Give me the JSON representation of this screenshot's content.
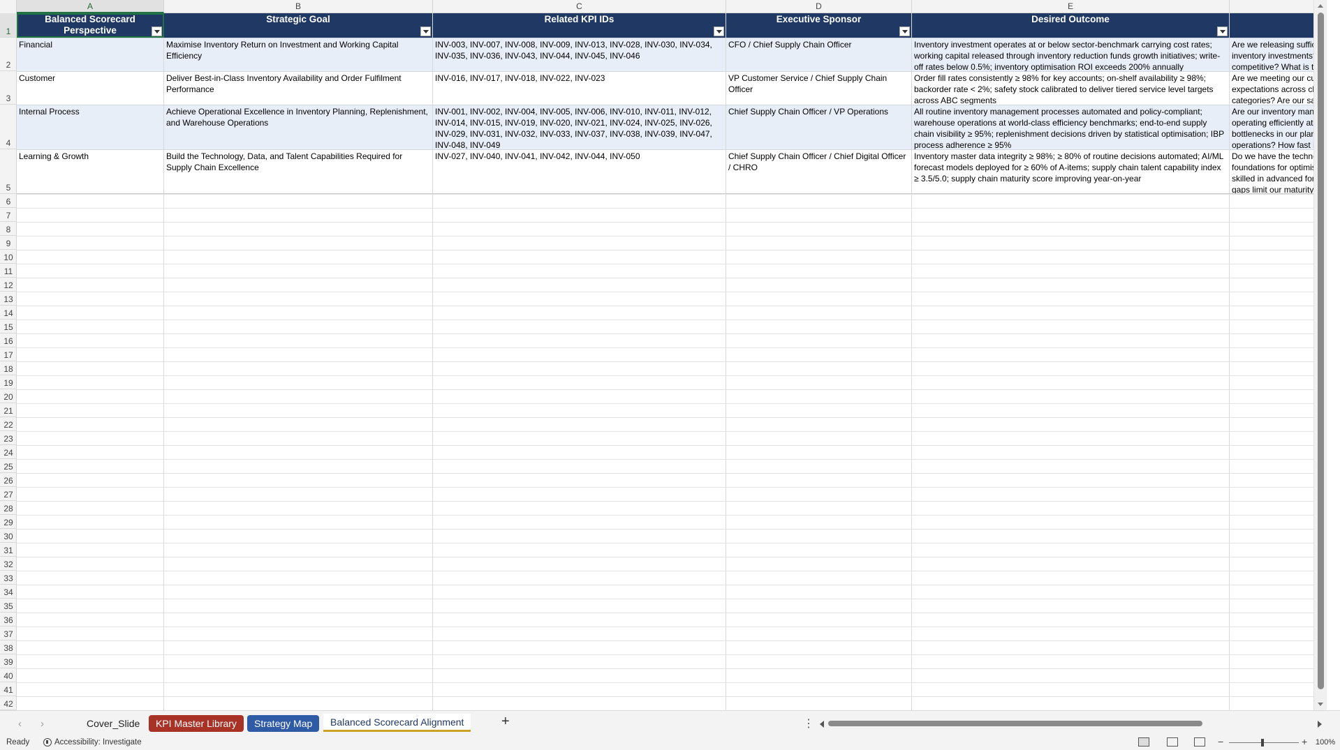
{
  "columns": [
    "A",
    "B",
    "C",
    "D",
    "E"
  ],
  "headers": {
    "a": "Balanced Scorecard Perspective",
    "b": "Strategic Goal",
    "c": "Related KPI IDs",
    "d": "Executive Sponsor",
    "e": "Desired Outcome"
  },
  "rows": [
    {
      "perspective": "Financial",
      "goal": "Maximise Inventory Return on Investment and Working Capital Efficiency",
      "kpis": "INV-003, INV-007, INV-008, INV-009, INV-013, INV-028, INV-030, INV-034, INV-035, INV-036, INV-043, INV-044, INV-045, INV-046",
      "sponsor": "CFO / Chief Supply Chain Officer",
      "outcome": "Inventory investment operates at or below sector-benchmark carrying cost rates; working capital released through inventory reduction funds growth initiatives; write-off rates below 0.5%; inventory optimisation ROI exceeds 200% annually",
      "question": "Are we releasing sufficient working capital from inventory investments? Is our carrying cost competitive? What is the ROI on our supply chain optimisation?"
    },
    {
      "perspective": "Customer",
      "goal": "Deliver Best-in-Class Inventory Availability and Order Fulfilment Performance",
      "kpis": "INV-016, INV-017, INV-018, INV-022, INV-023",
      "sponsor": "VP Customer Service / Chief Supply Chain Officer",
      "outcome": "Order fill rates consistently ≥ 98% for key accounts; on-shelf availability ≥ 98%; backorder rate < 2%; safety stock calibrated to deliver tiered service level targets across ABC segments",
      "question": "Are we meeting our customers' availability expectations across channels and product categories? Are our safety stock levels correctly calibrated?"
    },
    {
      "perspective": "Internal Process",
      "goal": "Achieve Operational Excellence in Inventory Planning, Replenishment, and Warehouse Operations",
      "kpis": "INV-001, INV-002, INV-004, INV-005, INV-006, INV-010, INV-011, INV-012, INV-014, INV-015, INV-019, INV-020, INV-021, INV-024, INV-025, INV-026, INV-029, INV-031, INV-032, INV-033, INV-037, INV-038, INV-039, INV-047, INV-048, INV-049",
      "sponsor": "Chief Supply Chain Officer / VP Operations",
      "outcome": "All routine inventory management processes automated and policy-compliant; warehouse operations at world-class efficiency benchmarks; end-to-end supply chain visibility ≥ 95%; replenishment decisions driven by statistical optimisation; IBP process adherence ≥ 95%",
      "question": "Are our inventory management processes operating efficiently at scale? Where are the bottlenecks in our planning and replenishment operations? How fast is our disruption response?"
    },
    {
      "perspective": "Learning & Growth",
      "goal": "Build the Technology, Data, and Talent Capabilities Required for Supply Chain Excellence",
      "kpis": "INV-027, INV-040, INV-041, INV-042, INV-044, INV-050",
      "sponsor": "Chief Supply Chain Officer / Chief Digital Officer / CHRO",
      "outcome": "Inventory master data integrity ≥ 98%; ≥ 80% of routine decisions automated; AI/ML forecast models deployed for ≥ 60% of A-items; supply chain talent capability index ≥ 3.5/5.0; supply chain maturity score improving year-on-year",
      "question": "Do we have the technology and data foundations for optimisation? Are our planners skilled in advanced forecasting? What capability gaps limit our maturity score?"
    }
  ],
  "row_numbers": [
    "1",
    "2",
    "3",
    "4",
    "5",
    "6",
    "7",
    "8",
    "9",
    "10",
    "11",
    "12",
    "13",
    "14",
    "15",
    "16",
    "17",
    "18",
    "19",
    "20",
    "21",
    "22",
    "23",
    "24",
    "25",
    "26",
    "27",
    "28",
    "29",
    "30",
    "31",
    "32",
    "33",
    "34",
    "35",
    "36",
    "37",
    "38",
    "39",
    "40",
    "41",
    "42"
  ],
  "tabs": {
    "t1": "Cover_Slide",
    "t2": "KPI Master Library",
    "t3": "Strategy Map",
    "t4": "Balanced Scorecard Alignment",
    "add": "+",
    "prev": "‹",
    "next": "›",
    "more": "⋮"
  },
  "status": {
    "ready": "Ready",
    "accessibility": "Accessibility: Investigate",
    "zoom": "100%",
    "zoom_minus": "−",
    "zoom_plus": "+"
  },
  "colors": {
    "header_fill": "#1f3864",
    "band_fill": "#e8eef8",
    "tab_red": "#a93226",
    "tab_blue": "#2e5aa6",
    "active_tab_underline": "#c9a227",
    "selection": "#217346"
  },
  "icons": [
    "filter-dropdown-icon",
    "accessibility-icon",
    "normal-view-icon",
    "page-layout-icon",
    "page-break-icon"
  ]
}
